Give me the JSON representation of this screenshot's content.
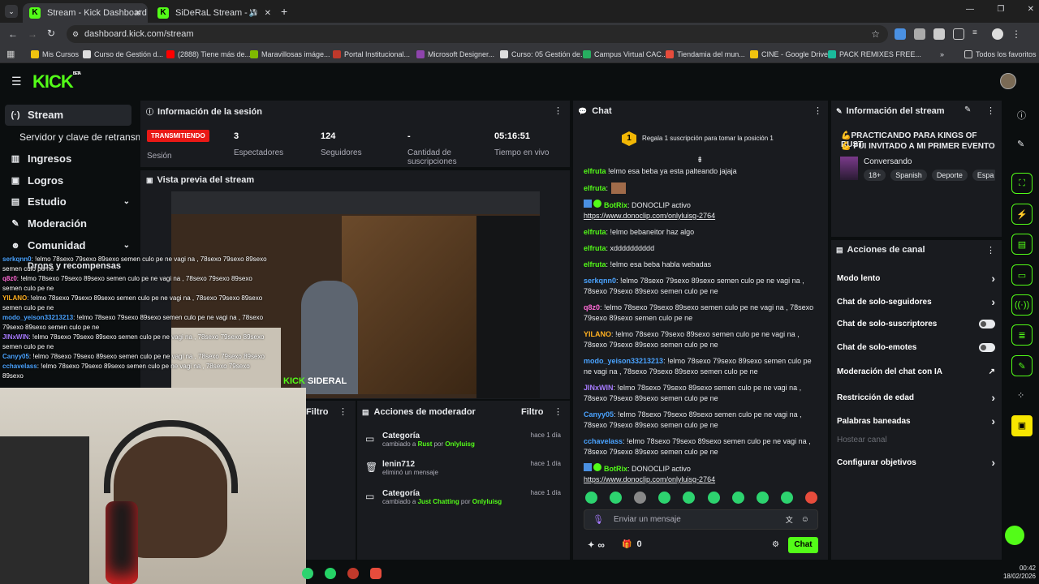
{
  "browser": {
    "tabs": [
      {
        "title": "Stream - Kick Dashboard"
      },
      {
        "title": "SiDeRaL Stream - Watch Li"
      }
    ],
    "url": "dashboard.kick.com/stream",
    "bookmarks": [
      "Mis Cursos",
      "Curso de Gestión d...",
      "(2888) Tiene más de...",
      "Maravillosas imáge...",
      "Portal Institucional...",
      "Microsoft Designer...",
      "Curso: 05 Gestión de...",
      "Campus Virtual CAC...",
      "Tiendamia del mun...",
      "CINE - Google Drive",
      "PACK REMIXES FREE..."
    ],
    "all_bookmarks": "Todos los favoritos"
  },
  "brand": {
    "logo": "KICK",
    "beta": "BETA",
    "accent": "#53fc18"
  },
  "sidebar": {
    "items": [
      {
        "label": "Stream",
        "icon": "stream-icon"
      },
      {
        "label": "Servidor y clave de retransmisión"
      },
      {
        "label": "Ingresos",
        "icon": "chart-icon"
      },
      {
        "label": "Logros",
        "icon": "trophy-icon"
      },
      {
        "label": "Estudio",
        "icon": "studio-icon"
      },
      {
        "label": "Moderación",
        "icon": "wrench-icon"
      },
      {
        "label": "Comunidad",
        "icon": "people-icon"
      },
      {
        "label": "Drops y recompensas"
      }
    ]
  },
  "session": {
    "title": "Información de la sesión",
    "status": "TRANSMITIENDO",
    "status_label": "Sesión",
    "stats": [
      {
        "value": "3",
        "label": "Espectadores"
      },
      {
        "value": "124",
        "label": "Seguidores"
      },
      {
        "value": "-",
        "label": "Cantidad de suscripciones"
      },
      {
        "value": "05:16:51",
        "label": "Tiempo en vivo"
      }
    ]
  },
  "preview": {
    "title": "Vista previa del stream",
    "watermark": "SIDERAL"
  },
  "overlay_chat": [
    {
      "user": "serkqnn0",
      "color": "#4aa3ff",
      "text": ": !elmo 78sexo 79sexo 89sexo semen culo pe ne vagi na , 78sexo 79sexo 89sexo semen culo pe ne"
    },
    {
      "user": "q8z0",
      "color": "#ff6bd6",
      "text": ": !elmo 78sexo 79sexo 89sexo semen culo pe ne vagi na , 78sexo 79sexo 89sexo semen culo pe ne"
    },
    {
      "user": "YILANO",
      "color": "#ffb020",
      "text": ": !elmo 78sexo 79sexo 89sexo semen culo pe ne vagi na , 78sexo 79sexo 89sexo semen culo pe ne"
    },
    {
      "user": "modo_yeison33213213",
      "color": "#4aa3ff",
      "text": ": !elmo 78sexo 79sexo 89sexo semen culo pe ne vagi na , 78sexo 79sexo 89sexo semen culo pe ne"
    },
    {
      "user": "JINxWIN",
      "color": "#a77bff",
      "text": ": !elmo 78sexo 79sexo 89sexo semen culo pe ne vagi na , 78sexo 79sexo 89sexo semen culo pe ne"
    },
    {
      "user": "Canyy05",
      "color": "#4aa3ff",
      "text": ": !elmo 78sexo 79sexo 89sexo semen culo pe ne vagi na , 78sexo 79sexo 89sexo"
    },
    {
      "user": "cchavelass",
      "color": "#4aa3ff",
      "text": ": !elmo 78sexo 79sexo 89sexo semen culo pe ne vagi na , 78sexo 79sexo 89sexo"
    }
  ],
  "filter_label": "Filtro",
  "modactions": {
    "title": "Acciones de moderador",
    "filter": "Filtro",
    "items": [
      {
        "title": "Categoría",
        "prefix": "cambiado a ",
        "target": "Rust",
        "by": " por ",
        "user": "Onlyluisg",
        "time": "hace 1 día"
      },
      {
        "title": "lenin712",
        "prefix": "eliminó un mensaje",
        "target": "",
        "by": "",
        "user": "",
        "time": "hace 1 día"
      },
      {
        "title": "Categoría",
        "prefix": "cambiado a ",
        "target": "Just Chatting",
        "by": " por ",
        "user": "Onlyluisg",
        "time": "hace 1 día"
      }
    ]
  },
  "chat": {
    "title": "Chat",
    "sub_rank": "1",
    "sub_promo": "Regala 1 suscripción para tomar la posición 1",
    "messages": [
      {
        "user": "elfruta",
        "color": "#53fc18",
        "text": " !elmo esa beba ya esta palteando jajaja"
      },
      {
        "user": "elfruta",
        "color": "#53fc18",
        "text": ":"
      },
      {
        "user": "BotRix",
        "color": "#53fc18",
        "text": ": DONOCLIP activo",
        "link": "https://www.donoclip.com/onlyluisg-2764"
      },
      {
        "user": "elfruta",
        "color": "#53fc18",
        "text": ": !elmo bebaneitor haz algo"
      },
      {
        "user": "elfruta",
        "color": "#53fc18",
        "text": ": xdddddddddd"
      },
      {
        "user": "elfruta",
        "color": "#53fc18",
        "text": ": !elmo esa beba habla webadas"
      },
      {
        "user": "serkqnn0",
        "color": "#4aa3ff",
        "text": ": !elmo 78sexo 79sexo 89sexo semen culo pe ne vagi na , 78sexo 79sexo 89sexo semen culo pe ne"
      },
      {
        "user": "q8z0",
        "color": "#ff6bd6",
        "text": ": !elmo 78sexo 79sexo 89sexo semen culo pe ne vagi na , 78sexo 79sexo 89sexo semen culo pe ne"
      },
      {
        "user": "YILANO",
        "color": "#ffb020",
        "text": ": !elmo 78sexo 79sexo 89sexo semen culo pe ne vagi na , 78sexo 79sexo 89sexo semen culo pe ne"
      },
      {
        "user": "modo_yeison33213213",
        "color": "#4aa3ff",
        "text": ": !elmo 78sexo 79sexo 89sexo semen culo pe ne vagi na , 78sexo 79sexo 89sexo semen culo pe ne"
      },
      {
        "user": "JINxWIN",
        "color": "#a77bff",
        "text": ": !elmo 78sexo 79sexo 89sexo semen culo pe ne vagi na , 78sexo 79sexo 89sexo semen culo pe ne"
      },
      {
        "user": "Canyy05",
        "color": "#4aa3ff",
        "text": ": !elmo 78sexo 79sexo 89sexo semen culo pe ne vagi na , 78sexo 79sexo 89sexo semen culo pe ne"
      },
      {
        "user": "cchavelass",
        "color": "#4aa3ff",
        "text": ": !elmo 78sexo 79sexo 89sexo semen culo pe ne vagi na , 78sexo 79sexo 89sexo semen culo pe ne"
      },
      {
        "user": "BotRix",
        "color": "#53fc18",
        "text": ": DONOCLIP activo",
        "link": "https://www.donoclip.com/onlyluisg-2764"
      }
    ],
    "input_placeholder": "Enviar un mensaje",
    "points": "∞",
    "gifts": "0",
    "send_label": "Chat"
  },
  "stream_info": {
    "title": "Información del stream",
    "line1": "💪PRACTICANDO PARA KINGS OF RUST",
    "line2": "💪 FUI INVITADO A MI PRIMER EVENTO",
    "category": "Conversando",
    "tags": [
      "18+",
      "Spanish",
      "Deporte",
      "Espa"
    ]
  },
  "channel_actions": {
    "title": "Acciones de canal",
    "items": [
      {
        "label": "Modo lento",
        "control": "chevron"
      },
      {
        "label": "Chat de solo-seguidores",
        "control": "chevron"
      },
      {
        "label": "Chat de solo-suscriptores",
        "control": "toggle"
      },
      {
        "label": "Chat de solo-emotes",
        "control": "toggle"
      },
      {
        "label": "Moderación del chat con IA",
        "control": "external"
      },
      {
        "label": "Restricción de edad",
        "control": "chevron"
      },
      {
        "label": "Palabras baneadas",
        "control": "chevron"
      },
      {
        "label": "Hostear canal",
        "control": "none",
        "disabled": true
      },
      {
        "label": "Configurar objetivos",
        "control": "chevron"
      }
    ]
  },
  "clock": {
    "time": "00:42",
    "date": "18/02/2026"
  }
}
